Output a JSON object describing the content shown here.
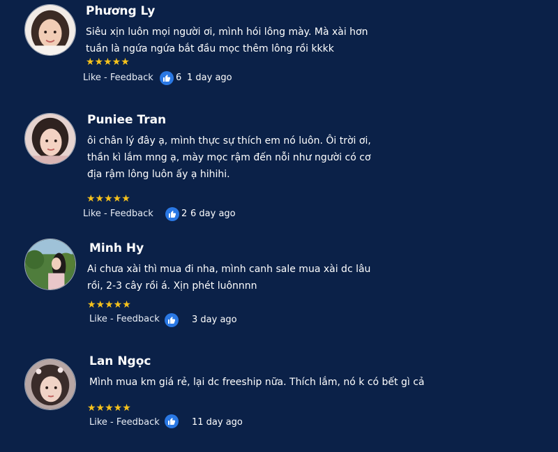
{
  "reviews": [
    {
      "name": "Phương Ly",
      "lines": [
        "Siêu xịn luôn mọi người ơi, mình hói lông mày. Mà xài hơn",
        "tuần là ngứa ngứa bắt đầu mọc thêm lông rồi kkkk"
      ],
      "stars": "★★★★★",
      "like_feedback": "Like - Feedback",
      "likes": "6",
      "time": "1 day ago"
    },
    {
      "name": "Puniee Tran",
      "lines": [
        "ôi chân lý đây ạ, mình thực sự thích em nó luôn. Ôi trời ơi,",
        "thần kì lắm mng ạ, mày mọc rậm đến nỗi như người có cơ",
        "địa rậm lông luôn ấy ạ hihihi."
      ],
      "stars": "★★★★★",
      "like_feedback": "Like - Feedback",
      "likes": "2",
      "time": "6 day ago"
    },
    {
      "name": "Minh Hy",
      "lines": [
        "Ai chưa xài thì mua đi nha, mình canh sale mua xài dc lâu",
        "rồi, 2-3 cây rồi á. Xịn phét luônnnn"
      ],
      "stars": "★★★★★",
      "like_feedback": "Like - Feedback",
      "likes": "",
      "time": "3 day ago"
    },
    {
      "name": "Lan Ngọc",
      "lines": [
        "Mình mua km giá rẻ, lại dc freeship nữa. Thích lắm, nó k có bết gì cả"
      ],
      "stars": "★★★★★",
      "like_feedback": "Like - Feedback",
      "likes": "",
      "time": "11 day ago"
    }
  ],
  "colors": {
    "background": "#0b2148",
    "star": "#f6c21c",
    "like_badge": "#2a78e4"
  },
  "icons": [
    "avatar",
    "star-icon",
    "thumbs-up-icon"
  ]
}
